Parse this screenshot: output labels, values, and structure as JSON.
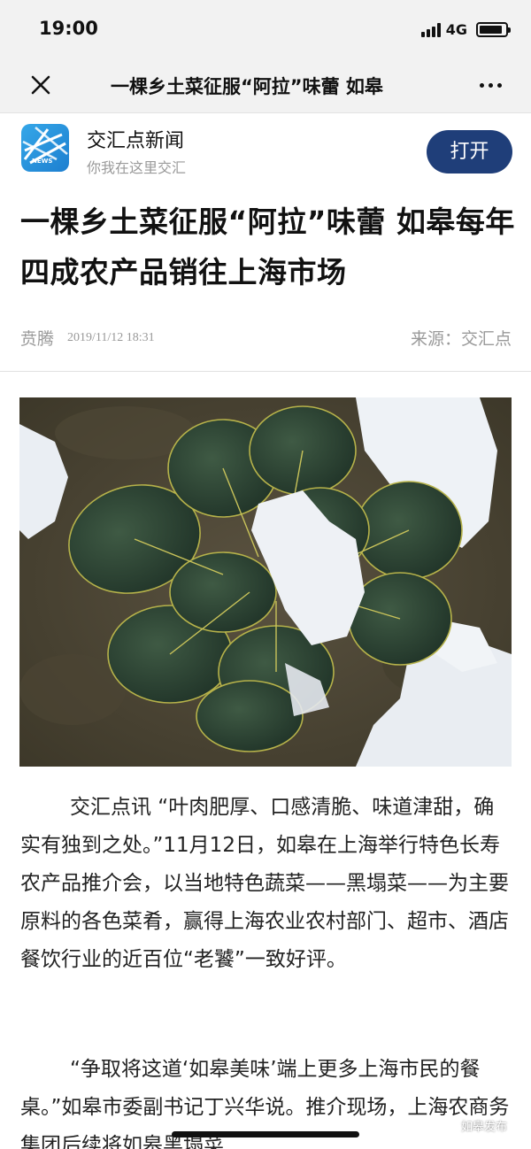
{
  "status_bar": {
    "time": "19:00",
    "network": "4G",
    "battery_level": 0.9
  },
  "nav": {
    "title": "一棵乡土菜征服“阿拉”味蕾 如皋",
    "close_icon": "close-icon",
    "more_icon": "more-dots-icon"
  },
  "app_banner": {
    "name": "交汇点新闻",
    "slogan": "你我在这里交汇",
    "logo_text": "NEWS",
    "open_label": "打开",
    "open_color": "#1f3e79",
    "logo_color": "#2a90dc"
  },
  "article": {
    "title": "一棵乡土菜征服“阿拉”味蕾 如皋每年四成农产品销往上海市场",
    "author": "贲腾",
    "date": "2019/11/12 18:31",
    "source": "来源：交汇点",
    "image_icon": "vegetable-in-snow-photo",
    "paragraphs": [
      "交汇点讯 “叶肉肥厚、口感清脆、味道津甜，确实有独到之处。”11月12日，如皋在上海举行特色长寿农产品推介会，以当地特色蔬菜——黑塌菜——为主要原料的各色菜肴，赢得上海农业农村部门、超市、酒店餐饮行业的近百位“老饕”一致好评。",
      "“争取将这道‘如皋美味’端上更多上海市民的餐桌。”如皋市委副书记丁兴华说。推介现场，上海农商务集团后续将如皋黑塌菜"
    ]
  },
  "watermark": {
    "text": "如皋发布",
    "icon": "wechat-icon"
  }
}
